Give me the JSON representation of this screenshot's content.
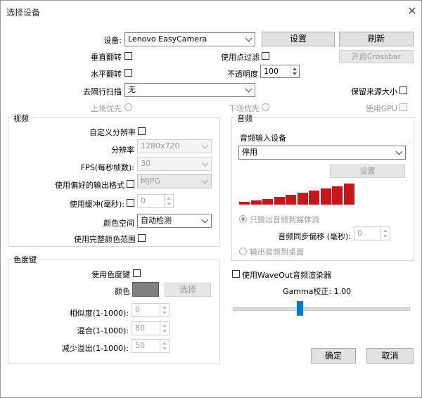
{
  "window": {
    "title": "选择设备",
    "close": "✕"
  },
  "top": {
    "device_label": "设备:",
    "device_value": "Lenovo EasyCamera",
    "config_btn": "设置",
    "refresh_btn": "刷新",
    "vflip_label": "垂直翻转",
    "use_filter_label": "使用点过滤",
    "crossbar_btn": "开启Crossbar",
    "hflip_label": "水平翻转",
    "opacity_label": "不透明度",
    "opacity_value": "100",
    "deinterlace_label": "去隔行扫描",
    "deinterlace_value": "无",
    "keep_size_label": "保留来源大小",
    "top_field_label": "上场优先",
    "bottom_field_label": "下场优先",
    "use_gpu_label": "使用GPU"
  },
  "video": {
    "group_title": "视频",
    "custom_res_label": "自定义分辨率",
    "res_label": "分辨率",
    "res_value": "1280x720",
    "fps_label": "FPS(每秒帧数):",
    "fps_value": "30",
    "pref_format_label": "使用偏好的输出格式",
    "format_value": "MJPG",
    "buffer_label": "使用缓冲(毫秒):",
    "buffer_value": "0",
    "colorspace_label": "颜色空间",
    "colorspace_value": "自动检测",
    "full_range_label": "使用完整颜色范围"
  },
  "audio": {
    "group_title": "音频",
    "input_label": "音频输入设备",
    "input_value": "停用",
    "config_btn": "设置",
    "meter_levels": [
      0.12,
      0.2,
      0.28,
      0.36,
      0.45,
      0.55,
      0.65,
      0.75,
      0.85,
      1.0
    ],
    "meter_color": "#c8161d",
    "output_stream_label": "只输出音频到媒体流",
    "offset_label": "音频同步偏移 (毫秒):",
    "offset_value": "0",
    "output_desktop_label": "输出音频到桌面"
  },
  "waveout": {
    "label": "使用WaveOut音频渲染器",
    "gamma_label": "Gamma校正: ",
    "gamma_value": "1.00",
    "gamma_position": 0.38
  },
  "chroma": {
    "group_title": "色度键",
    "use_label": "使用色度键",
    "color_label": "颜色",
    "color_value": "#808080",
    "select_btn": "选择",
    "similarity_label": "相似度(1-1000):",
    "similarity_value": "0",
    "blend_label": "混合(1-1000):",
    "blend_value": "80",
    "spill_label": "减少溢出(1-1000):",
    "spill_value": "50"
  },
  "footer": {
    "ok": "确定",
    "cancel": "取消"
  }
}
